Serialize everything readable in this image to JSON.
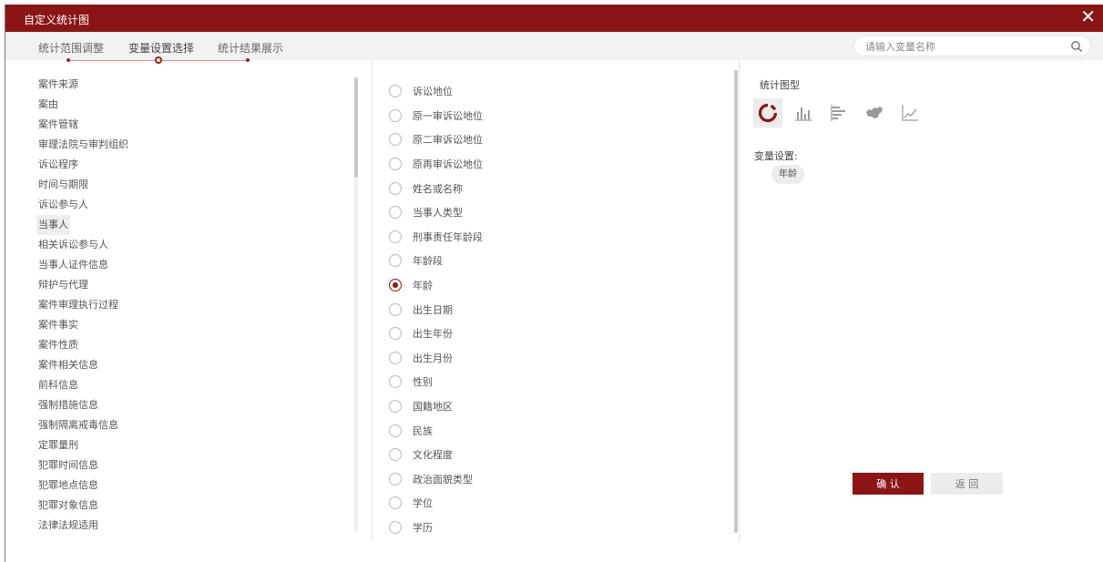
{
  "window": {
    "title": "自定义统计图",
    "close_glyph": "✕"
  },
  "tabs": [
    {
      "label": "统计范围调整"
    },
    {
      "label": "变量设置选择"
    },
    {
      "label": "统计结果展示"
    }
  ],
  "search": {
    "placeholder": "请输入变量名称"
  },
  "categories": [
    "案件来源",
    "案由",
    "案件管辖",
    "审理法院与审判组织",
    "诉讼程序",
    "时间与期限",
    "诉讼参与人",
    "当事人",
    "相关诉讼参与人",
    "当事人证件信息",
    "辩护与代理",
    "案件审理执行过程",
    "案件事实",
    "案件性质",
    "案件相关信息",
    "前科信息",
    "强制措施信息",
    "强制隔离戒毒信息",
    "定罪量刑",
    "犯罪时间信息",
    "犯罪地点信息",
    "犯罪对象信息",
    "法律法规适用"
  ],
  "highlighted_category": "当事人",
  "variables": [
    {
      "label": "诉讼地位",
      "checked": false
    },
    {
      "label": "原一审诉讼地位",
      "checked": false
    },
    {
      "label": "原二审诉讼地位",
      "checked": false
    },
    {
      "label": "原再审诉讼地位",
      "checked": false
    },
    {
      "label": "姓名或名称",
      "checked": false
    },
    {
      "label": "当事人类型",
      "checked": false
    },
    {
      "label": "刑事责任年龄段",
      "checked": false
    },
    {
      "label": "年龄段",
      "checked": false
    },
    {
      "label": "年龄",
      "checked": true
    },
    {
      "label": "出生日期",
      "checked": false
    },
    {
      "label": "出生年份",
      "checked": false
    },
    {
      "label": "出生月份",
      "checked": false
    },
    {
      "label": "性别",
      "checked": false
    },
    {
      "label": "国籍地区",
      "checked": false
    },
    {
      "label": "民族",
      "checked": false
    },
    {
      "label": "文化程度",
      "checked": false
    },
    {
      "label": "政治面貌类型",
      "checked": false
    },
    {
      "label": "学位",
      "checked": false
    },
    {
      "label": "学历",
      "checked": false
    }
  ],
  "stat_panel": {
    "title": "统计图型",
    "chart_types": [
      {
        "icon": "donut-chart-icon",
        "selected": true
      },
      {
        "icon": "bar-chart-icon",
        "selected": false
      },
      {
        "icon": "horizontal-bar-chart-icon",
        "selected": false
      },
      {
        "icon": "map-chart-icon",
        "selected": false
      },
      {
        "icon": "line-chart-icon",
        "selected": false
      }
    ],
    "var_settings_label": "变量设置:",
    "selected_variable": "年龄",
    "confirm_label": "确 认",
    "back_label": "返 回"
  },
  "colors": {
    "accent": "#8b1515",
    "tab_bar": "#f2f2f2",
    "chip": "#ececec"
  }
}
